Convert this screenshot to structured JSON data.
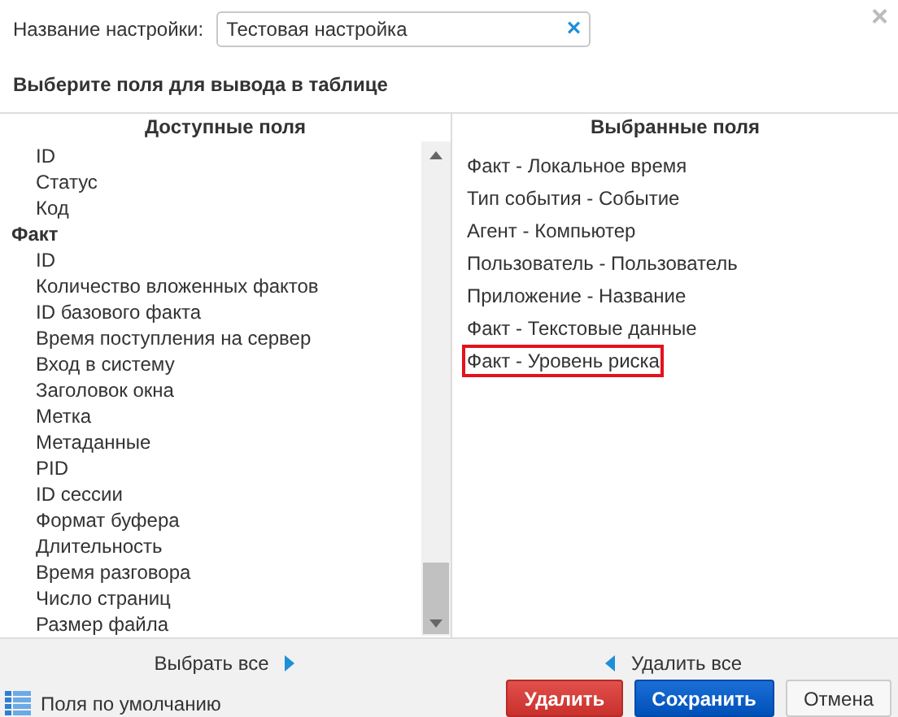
{
  "name_field": {
    "label": "Название настройки:",
    "value": "Тестовая настройка",
    "clear": "×"
  },
  "close": "×",
  "heading": "Выберите поля для вывода в таблице",
  "available": {
    "title": "Доступные поля",
    "groups": [
      {
        "children": [
          {
            "label": "ID"
          },
          {
            "label": "Статус"
          },
          {
            "label": "Код"
          }
        ]
      },
      {
        "label": "Факт",
        "children": [
          {
            "label": "ID"
          },
          {
            "label": "Количество вложенных фактов"
          },
          {
            "label": "ID базового факта"
          },
          {
            "label": "Время поступления на сервер"
          },
          {
            "label": "Вход в систему"
          },
          {
            "label": "Заголовок окна"
          },
          {
            "label": "Метка"
          },
          {
            "label": "Метаданные"
          },
          {
            "label": "PID"
          },
          {
            "label": "ID сессии"
          },
          {
            "label": "Формат буфера"
          },
          {
            "label": "Длительность"
          },
          {
            "label": "Время разговора"
          },
          {
            "label": "Число страниц"
          },
          {
            "label": "Размер файла"
          }
        ]
      }
    ]
  },
  "chosen": {
    "title": "Выбранные поля",
    "items": [
      {
        "label": "Факт - Локальное время",
        "selected": false
      },
      {
        "label": "Тип события - Событие",
        "selected": false
      },
      {
        "label": "Агент - Компьютер",
        "selected": false
      },
      {
        "label": "Пользователь - Пользователь",
        "selected": false
      },
      {
        "label": "Приложение - Название",
        "selected": false
      },
      {
        "label": "Факт - Текстовые данные",
        "selected": false
      },
      {
        "label": "Факт - Уровень риска",
        "selected": true
      }
    ]
  },
  "select_all": "Выбрать все",
  "remove_all": "Удалить все",
  "defaults_link": "Поля по умолчанию",
  "buttons": [
    {
      "label": "Удалить",
      "kind": "danger"
    },
    {
      "label": "Сохранить",
      "kind": "primary"
    },
    {
      "label": "Отмена",
      "kind": "plain"
    }
  ]
}
